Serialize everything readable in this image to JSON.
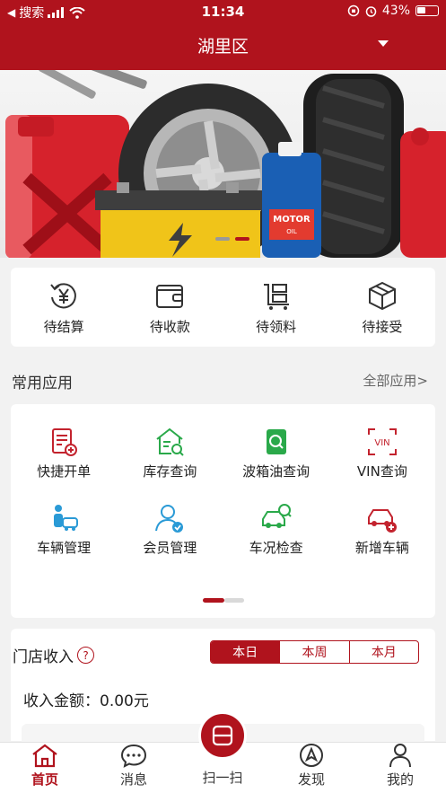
{
  "status_bar": {
    "carrier": "搜索",
    "time": "11:34",
    "battery": "43%"
  },
  "header": {
    "district": "湖里区"
  },
  "banner": {
    "pages": 2,
    "active_page": 2
  },
  "quick_actions": [
    {
      "label": "待结算",
      "icon": "yen-refresh-icon"
    },
    {
      "label": "待收款",
      "icon": "wallet-icon"
    },
    {
      "label": "待领料",
      "icon": "cart-shelf-icon"
    },
    {
      "label": "待接受",
      "icon": "package-icon"
    }
  ],
  "common_apps": {
    "title": "常用应用",
    "all_label": "全部应用>",
    "items": [
      {
        "label": "快捷开单",
        "icon": "quick-order-icon",
        "color": "#c3232e"
      },
      {
        "label": "库存查询",
        "icon": "warehouse-search-icon",
        "color": "#2aa94a"
      },
      {
        "label": "波箱油查询",
        "icon": "oil-search-icon",
        "color": "#2aa94a"
      },
      {
        "label": "VIN查询",
        "icon": "vin-scan-icon",
        "color": "#c3232e"
      },
      {
        "label": "车辆管理",
        "icon": "vehicle-manage-icon",
        "color": "#2a9ad6"
      },
      {
        "label": "会员管理",
        "icon": "member-manage-icon",
        "color": "#2a9ad6"
      },
      {
        "label": "车况检查",
        "icon": "car-inspect-icon",
        "color": "#2aa94a"
      },
      {
        "label": "新增车辆",
        "icon": "add-car-icon",
        "color": "#c3232e"
      }
    ]
  },
  "store_income": {
    "title": "门店收入",
    "tabs": [
      "本日",
      "本周",
      "本月"
    ],
    "active_tab": "本日",
    "amount_text": "收入金额：0.00元"
  },
  "tab_bar": {
    "items": [
      {
        "label": "首页",
        "icon": "home-icon",
        "active": true
      },
      {
        "label": "消息",
        "icon": "message-icon",
        "active": false
      },
      {
        "label": "扫一扫",
        "icon": "scan-icon",
        "active": false
      },
      {
        "label": "发现",
        "icon": "compass-icon",
        "active": false
      },
      {
        "label": "我的",
        "icon": "user-icon",
        "active": false
      }
    ]
  },
  "colors": {
    "brand": "#b0131d",
    "green": "#2aa94a",
    "blue": "#2a9ad6"
  }
}
